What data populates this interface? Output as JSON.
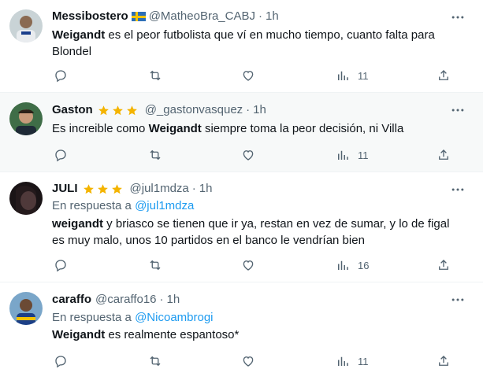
{
  "tweets": [
    {
      "name": "Messibostero",
      "handle": "@MatheoBra_CABJ",
      "time": "1h",
      "text_bold": "Weigandt",
      "text_rest_1": " es el peor futbolista que ví en mucho tiempo, cuanto falta para",
      "text_rest_2": "Blondel",
      "views": "11",
      "flag_icon": "sweden-flag-icon"
    },
    {
      "name": "Gaston",
      "handle": "@_gastonvasquez",
      "time": "1h",
      "text_pre": "Es increible como ",
      "text_bold": "Weigandt",
      "text_post": " siempre toma la peor decisión, ni Villa",
      "views": "11",
      "stars": 3
    },
    {
      "name": "JULI",
      "handle": "@jul1mdza",
      "time": "1h",
      "reply_prefix": "En respuesta a",
      "reply_handle": "@jul1mdza",
      "text_bold": "weigandt",
      "text_rest_1": " y briasco se tienen que ir ya, restan en vez de sumar, y lo de figal",
      "text_rest_2": "es muy malo, unos 10 partidos en el banco le vendrían bien",
      "views": "16",
      "stars": 3
    },
    {
      "name": "caraffo",
      "handle": "@caraffo16",
      "time": "1h",
      "reply_prefix": "En respuesta a",
      "reply_handle": "@Nicoambrogi",
      "text_bold": "Weigandt",
      "text_post": " es realmente espantoso*",
      "views": "11"
    }
  ],
  "colors": {
    "star": "#f4b400",
    "link": "#1d9bf0",
    "muted": "#536471",
    "highlight": "#f7f9f9"
  },
  "icons": [
    "reply-icon",
    "retweet-icon",
    "like-icon",
    "views-icon",
    "share-icon",
    "more-icon"
  ]
}
